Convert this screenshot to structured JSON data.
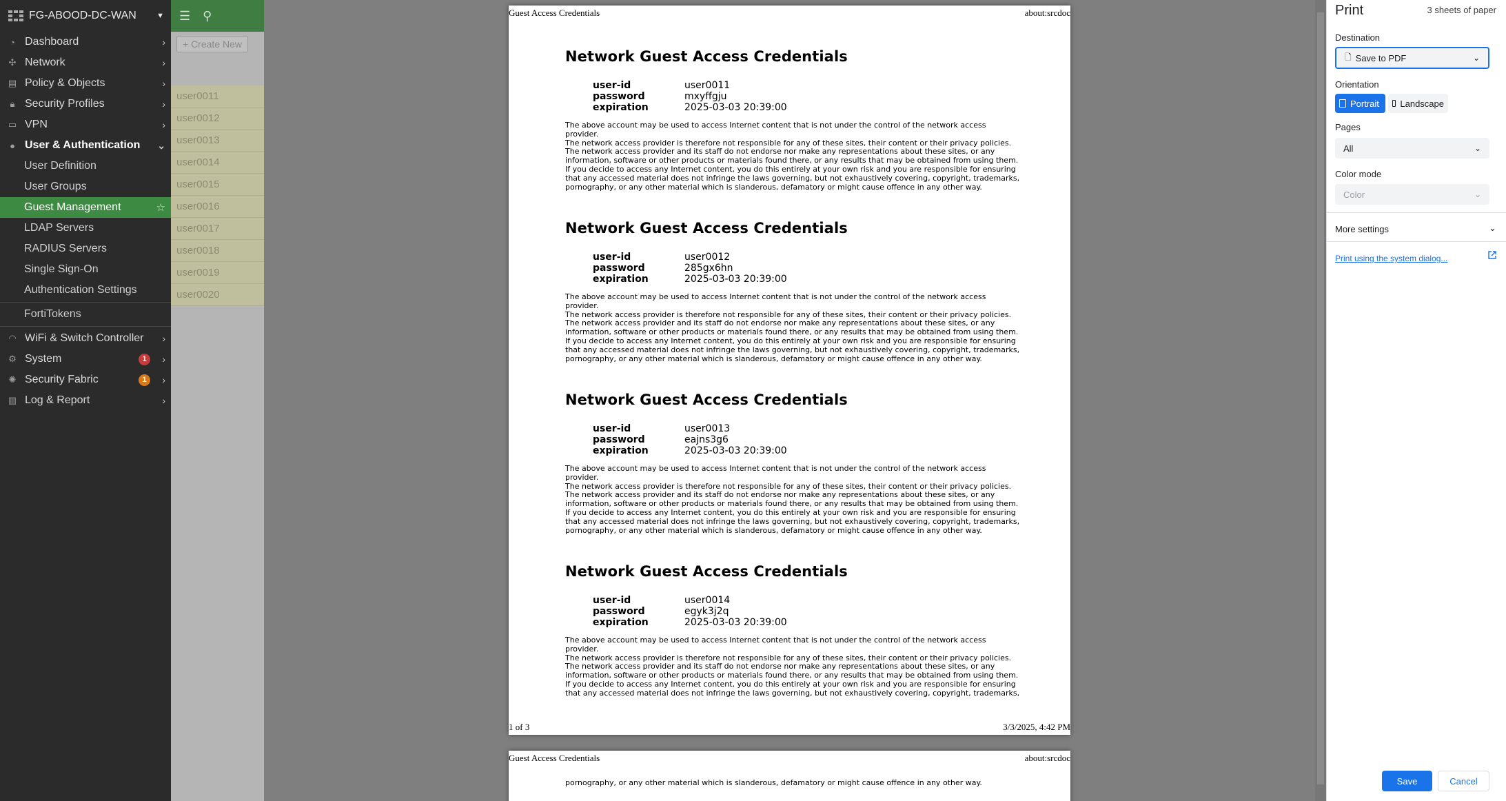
{
  "sidebar": {
    "device_name": "FG-ABOOD-DC-WAN",
    "items": [
      {
        "label": "Dashboard",
        "icon": "dashboard-icon"
      },
      {
        "label": "Network",
        "icon": "network-icon"
      },
      {
        "label": "Policy & Objects",
        "icon": "policy-icon"
      },
      {
        "label": "Security Profiles",
        "icon": "lock-icon"
      },
      {
        "label": "VPN",
        "icon": "laptop-icon"
      },
      {
        "label": "User & Authentication",
        "icon": "user-icon"
      }
    ],
    "sub_items": [
      "User Definition",
      "User Groups",
      "Guest Management",
      "LDAP Servers",
      "RADIUS Servers",
      "Single Sign-On",
      "Authentication Settings"
    ],
    "fortitokens": "FortiTokens",
    "bottom_items": [
      {
        "label": "WiFi & Switch Controller",
        "icon": "wifi-icon"
      },
      {
        "label": "System",
        "icon": "gear-icon",
        "badge": "1"
      },
      {
        "label": "Security Fabric",
        "icon": "fabric-icon",
        "badge": "1"
      },
      {
        "label": "Log & Report",
        "icon": "chart-icon"
      }
    ]
  },
  "app": {
    "create_new": "+ Create New",
    "rows": [
      "user0011",
      "user0012",
      "user0013",
      "user0014",
      "user0015",
      "user0016",
      "user0017",
      "user0018",
      "user0019",
      "user0020"
    ]
  },
  "preview": {
    "header_left": "Guest Access Credentials",
    "header_right": "about:srcdoc",
    "footer_left": "1 of 3",
    "footer_right": "3/3/2025, 4:42 PM",
    "heading": "Network Guest Access Credentials",
    "labels": {
      "user_id": "user-id",
      "password": "password",
      "expiration": "expiration"
    },
    "disclaimer": "The above account may be used to access Internet content that is not under the control of the network access provider.\nThe network access provider is therefore not responsible for any of these sites, their content or their privacy policies.\nThe network access provider and its staff do not endorse nor make any representations about these sites, or any\ninformation, software or other products or materials found there, or any results that may be obtained from using them.\nIf you decide to access any Internet content, you do this entirely at your own risk and you are responsible for ensuring\nthat any accessed material does not infringe the laws governing, but not exhaustively covering, copyright, trademarks,\npornography, or any other material which is slanderous, defamatory or might cause offence in any other way.",
    "disclaimer_last": "The above account may be used to access Internet content that is not under the control of the network access provider.\nThe network access provider is therefore not responsible for any of these sites, their content or their privacy policies.\nThe network access provider and its staff do not endorse nor make any representations about these sites, or any\ninformation, software or other products or materials found there, or any results that may be obtained from using them.\nIf you decide to access any Internet content, you do this entirely at your own risk and you are responsible for ensuring\nthat any accessed material does not infringe the laws governing, but not exhaustively covering, copyright, trademarks,",
    "page2_line": "pornography, or any other material which is slanderous, defamatory or might cause offence in any other way.",
    "credentials": [
      {
        "user_id": "user0011",
        "password": "mxyffgju",
        "expiration": "2025-03-03 20:39:00"
      },
      {
        "user_id": "user0012",
        "password": "285gx6hn",
        "expiration": "2025-03-03 20:39:00"
      },
      {
        "user_id": "user0013",
        "password": "eajns3g6",
        "expiration": "2025-03-03 20:39:00"
      },
      {
        "user_id": "user0014",
        "password": "egyk3j2q",
        "expiration": "2025-03-03 20:39:00"
      }
    ]
  },
  "dialog": {
    "title": "Print",
    "sheets": "3 sheets of paper",
    "destination_label": "Destination",
    "destination_value": "Save to PDF",
    "orientation_label": "Orientation",
    "portrait": "Portrait",
    "landscape": "Landscape",
    "pages_label": "Pages",
    "pages_value": "All",
    "color_label": "Color mode",
    "color_value": "Color",
    "more_settings": "More settings",
    "system_dialog": "Print using the system dialog...",
    "save": "Save",
    "cancel": "Cancel",
    "accent": "#1a73e8"
  }
}
